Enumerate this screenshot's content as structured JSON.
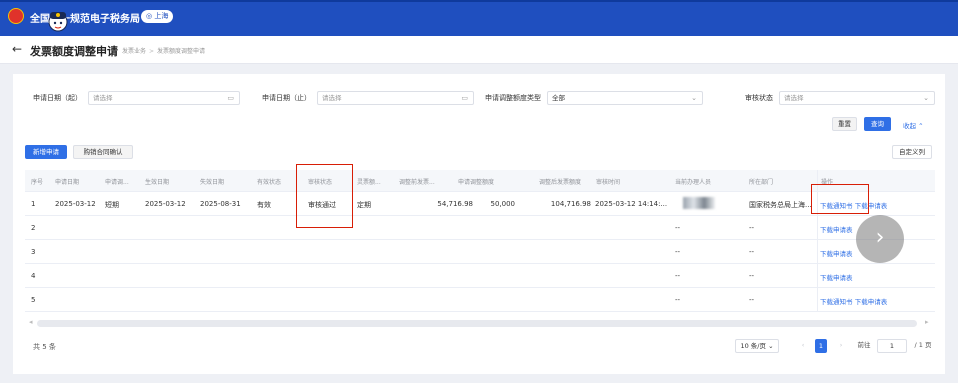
{
  "header": {
    "brand": "全国统一规范电子税务局",
    "city": "上海"
  },
  "titlebar": {
    "back_icon": "arrow-left-icon",
    "title": "发票额度调整申请",
    "breadcrumb": [
      "发票业务",
      "发票额度调整申请"
    ]
  },
  "filters": {
    "start_date_label": "申请日期（起）",
    "start_date_placeholder": "请选择",
    "end_date_label": "申请日期（止）",
    "end_date_placeholder": "请选择",
    "type_label": "申请调整额度类型",
    "type_value": "全部",
    "status_label": "审核状态",
    "status_placeholder": "请选择"
  },
  "actions": {
    "reset": "重置",
    "query": "查询",
    "collapse": "收起",
    "new_application": "新增申请",
    "purchase_confirm": "购销合同确认",
    "custom_columns": "自定义列"
  },
  "table": {
    "columns": [
      "序号",
      "申请日期",
      "申请调...",
      "生效日期",
      "失效日期",
      "有效状态",
      "审核状态",
      "灵票额...",
      "调整前发票...",
      "申请调整额度",
      "调整后发票额度",
      "审核时间",
      "当前办理人员",
      "所在部门",
      "操作"
    ],
    "rows": [
      {
        "no": "1",
        "apply_date": "2025-03-12",
        "adjust_type": "短期",
        "effective_date": "2025-03-12",
        "expire_date": "2025-08-31",
        "valid_status": "有效",
        "review_status": "审核通过",
        "quota_type": "定期",
        "before_amount": "54,716.98",
        "adjust_amount": "50,000",
        "after_amount": "104,716.98",
        "review_time": "2025-03-12 14:14:...",
        "handler": "",
        "department": "国家税务总局上海...",
        "ops": [
          "下载通知书",
          "下载申请表"
        ]
      },
      {
        "no": "2",
        "handler": "--",
        "department": "--",
        "ops": [
          "下载申请表"
        ]
      },
      {
        "no": "3",
        "handler": "--",
        "department": "--",
        "ops": [
          "下载申请表"
        ]
      },
      {
        "no": "4",
        "handler": "--",
        "department": "--",
        "ops": [
          "下载申请表"
        ]
      },
      {
        "no": "5",
        "handler": "--",
        "department": "--",
        "ops": [
          "下载通知书",
          "下载申请表"
        ]
      }
    ]
  },
  "pagination": {
    "total": "共 5 条",
    "page_size": "10 条/页",
    "current": "1",
    "goto_label": "前往",
    "goto_value": "1",
    "total_pages": "/ 1 页"
  },
  "colors": {
    "topbar": "#1f4fbf",
    "primary": "#2f6fe6",
    "highlight": "#d81e06"
  }
}
